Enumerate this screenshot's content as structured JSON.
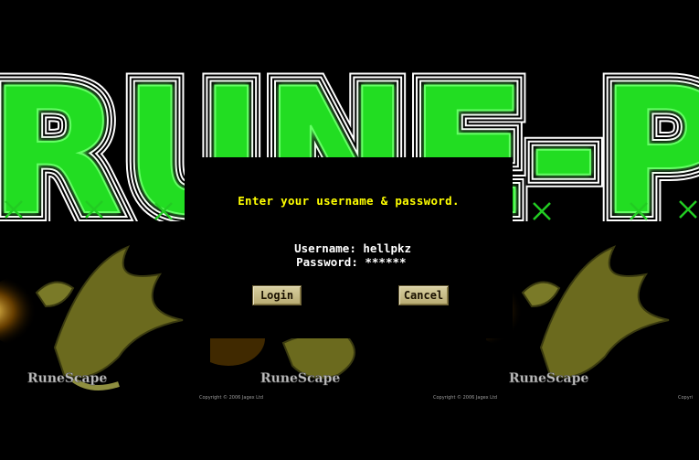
{
  "banner": {
    "text": "RUNE-PK",
    "text_color": "#33ff33"
  },
  "logo": {
    "text": "RuneScape"
  },
  "copyright_text": "Copyright © 2006 Jagex Ltd",
  "login": {
    "prompt": "Enter your username & password.",
    "username_label": "Username:",
    "username_value": "hellpkz",
    "password_label": "Password:",
    "password_value": "******",
    "login_button": "Login",
    "cancel_button": "Cancel"
  },
  "colors": {
    "prompt": "#ffff00",
    "field_text": "#ffffff",
    "button_bg": "#c8bc88"
  }
}
